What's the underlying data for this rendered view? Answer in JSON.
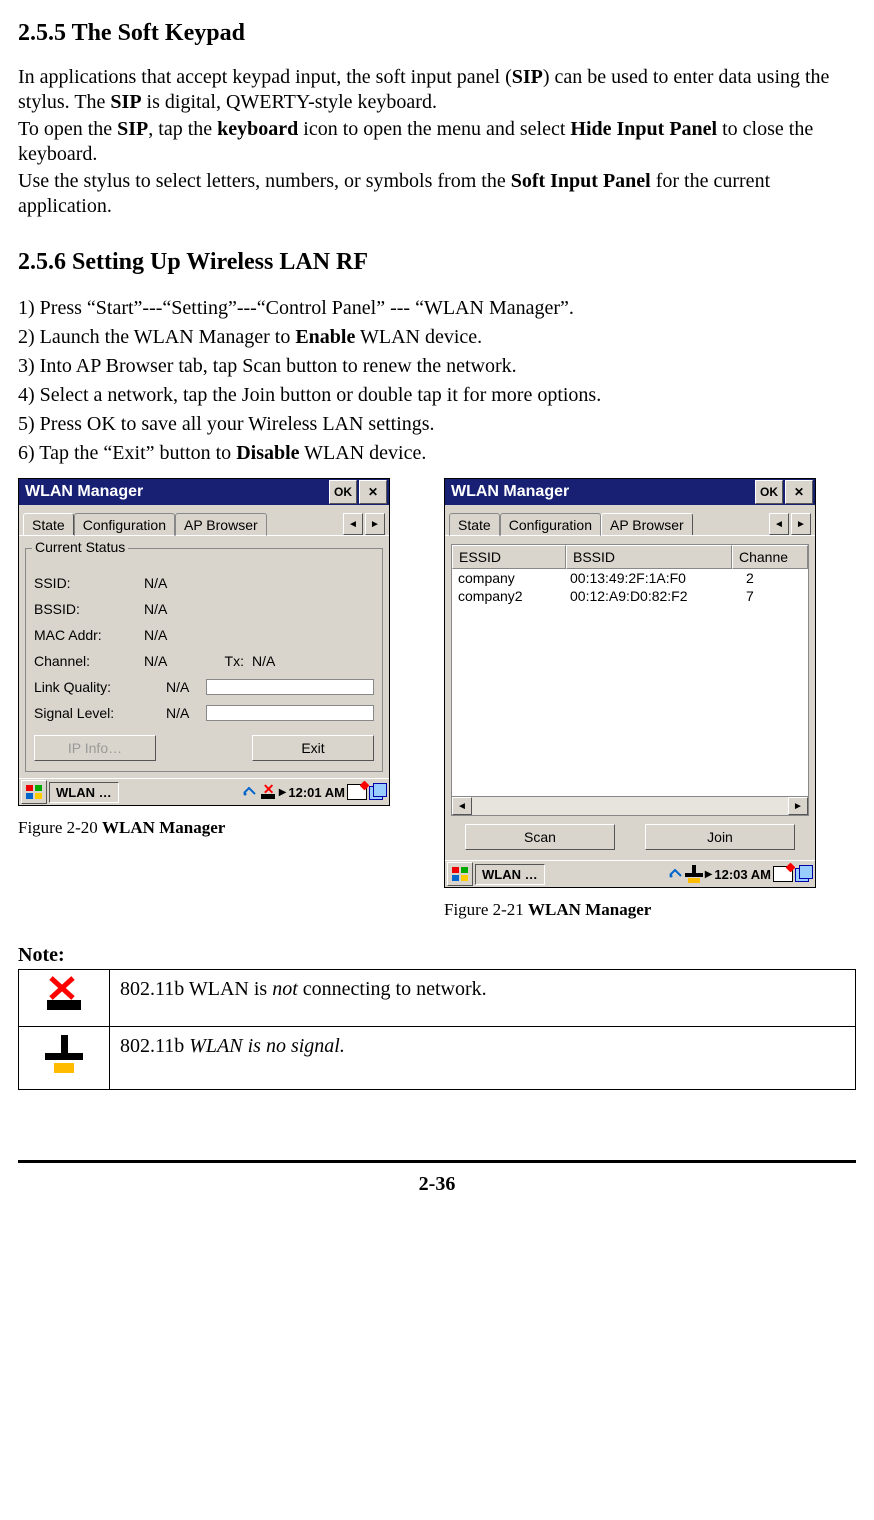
{
  "section1": {
    "title": "2.5.5 The Soft Keypad",
    "p1a": "In applications that accept keypad input, the soft input panel (",
    "p1b": "SIP",
    "p1c": ") can be used to enter data using the stylus. The ",
    "p1d": "SIP",
    "p1e": " is digital, QWERTY-style keyboard.",
    "p2a": "To open the ",
    "p2b": "SIP",
    "p2c": ", tap the ",
    "p2d": "keyboard",
    "p2e": " icon to open the menu and select ",
    "p2f": "Hide Input Panel",
    "p2g": " to close the keyboard.",
    "p3a": "Use the stylus to select letters, numbers, or symbols from the ",
    "p3b": "Soft Input Panel",
    "p3c": " for the current application."
  },
  "section2": {
    "title": "2.5.6 Setting Up Wireless LAN RF",
    "step1": "1) Press “Start”---“Setting”---“Control Panel” --- “WLAN Manager”.",
    "step2a": "2) Launch the WLAN Manager to ",
    "step2b": "Enable",
    "step2c": " WLAN device.",
    "step3": "3) Into AP Browser tab, tap Scan button to renew the network.",
    "step4": "4) Select a network, tap the Join button or double tap it for more options.",
    "step5": "5) Press OK to save all your Wireless LAN settings.",
    "step6a": "6) Tap the “Exit” button to ",
    "step6b": "Disable",
    "step6c": " WLAN device."
  },
  "win1": {
    "title": "WLAN Manager",
    "ok": "OK",
    "tabs": {
      "state": "State",
      "config": "Configuration",
      "ap": "AP Browser"
    },
    "group": "Current Status",
    "ssid_l": "SSID:",
    "ssid_v": "N/A",
    "bssid_l": "BSSID:",
    "bssid_v": "N/A",
    "mac_l": "MAC Addr:",
    "mac_v": "N/A",
    "chan_l": "Channel:",
    "chan_v": "N/A",
    "tx_l": "Tx:",
    "tx_v": "N/A",
    "lq_l": "Link Quality:",
    "lq_v": "N/A",
    "sl_l": "Signal Level:",
    "sl_v": "N/A",
    "ipinfo": "IP Info…",
    "exit": "Exit",
    "task": "WLAN …",
    "time": "12:01 AM"
  },
  "win2": {
    "title": "WLAN Manager",
    "ok": "OK",
    "tabs": {
      "state": "State",
      "config": "Configuration",
      "ap": "AP Browser"
    },
    "cols": {
      "essid": "ESSID",
      "bssid": "BSSID",
      "chan": "Channe"
    },
    "rows": [
      {
        "essid": "company",
        "bssid": "00:13:49:2F:1A:F0",
        "chan": "2"
      },
      {
        "essid": "company2",
        "bssid": "00:12:A9:D0:82:F2",
        "chan": "7"
      }
    ],
    "scan": "Scan",
    "join": "Join",
    "task": "WLAN …",
    "time": "12:03 AM"
  },
  "cap1a": "Figure 2-20 ",
  "cap1b": "WLAN Manager",
  "cap2a": "Figure 2-21 ",
  "cap2b": "WLAN Manager",
  "note_label": "Note:",
  "note1a": "802.11b WLAN is ",
  "note1b": "not ",
  "note1c": "connecting to network.",
  "note2a": "802.11b ",
  "note2b": "WLAN is no signal.",
  "page_number": "2-36"
}
